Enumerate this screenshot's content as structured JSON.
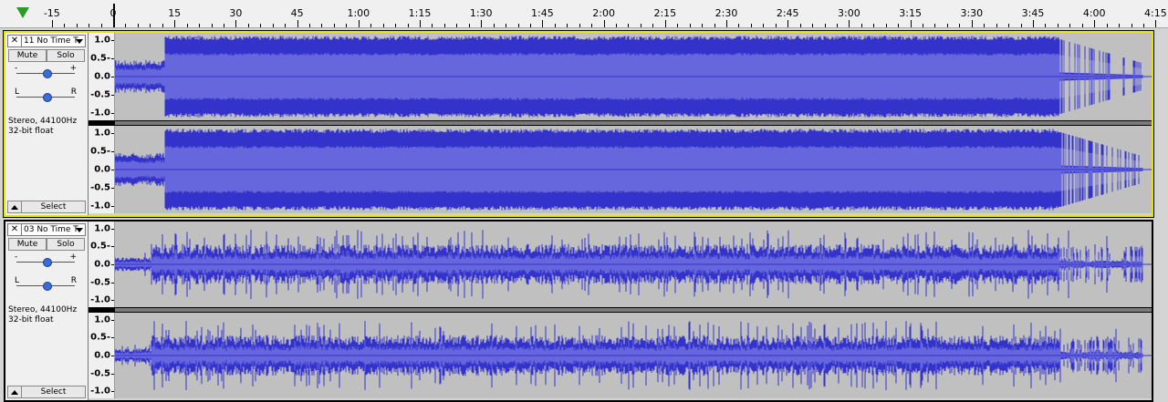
{
  "ruler": {
    "labels": [
      "-15",
      "0",
      "15",
      "30",
      "45",
      "1:00",
      "1:15",
      "1:30",
      "1:45",
      "2:00",
      "2:15",
      "2:30",
      "2:45",
      "3:00",
      "3:15",
      "3:30",
      "3:45",
      "4:00",
      "4:15"
    ]
  },
  "tracks": [
    {
      "name": "11 No Time T",
      "close": "✕",
      "mute": "Mute",
      "solo": "Solo",
      "gain_minus": "-",
      "gain_plus": "+",
      "pan_left": "L",
      "pan_right": "R",
      "info_rate": "Stereo, 44100Hz",
      "info_format": "32-bit float",
      "select": "Select",
      "scale": [
        "1.0",
        "0.5-",
        "0.0",
        "-0.5",
        "-1.0"
      ],
      "selected": true
    },
    {
      "name": "03 No Time T",
      "close": "✕",
      "mute": "Mute",
      "solo": "Solo",
      "gain_minus": "-",
      "gain_plus": "+",
      "pan_left": "L",
      "pan_right": "R",
      "info_rate": "Stereo, 44100Hz",
      "info_format": "32-bit float",
      "select": "Select",
      "scale": [
        "1.0",
        "0.5-",
        "0.0",
        "-0.5",
        "-1.0"
      ],
      "selected": false
    }
  ],
  "colors": {
    "waveform": "#3333cc",
    "waveform_rms": "#6666dd",
    "track_bg": "#c0c0c0",
    "selected_border": "#e6e600",
    "playhead_triangle": "#2a9a2a"
  },
  "icons": {
    "play_head": "play-head-triangle-icon",
    "close": "close-icon",
    "menu": "dropdown-arrow-icon",
    "collapse": "collapse-arrow-icon",
    "slider": "slider-knob-icon"
  }
}
